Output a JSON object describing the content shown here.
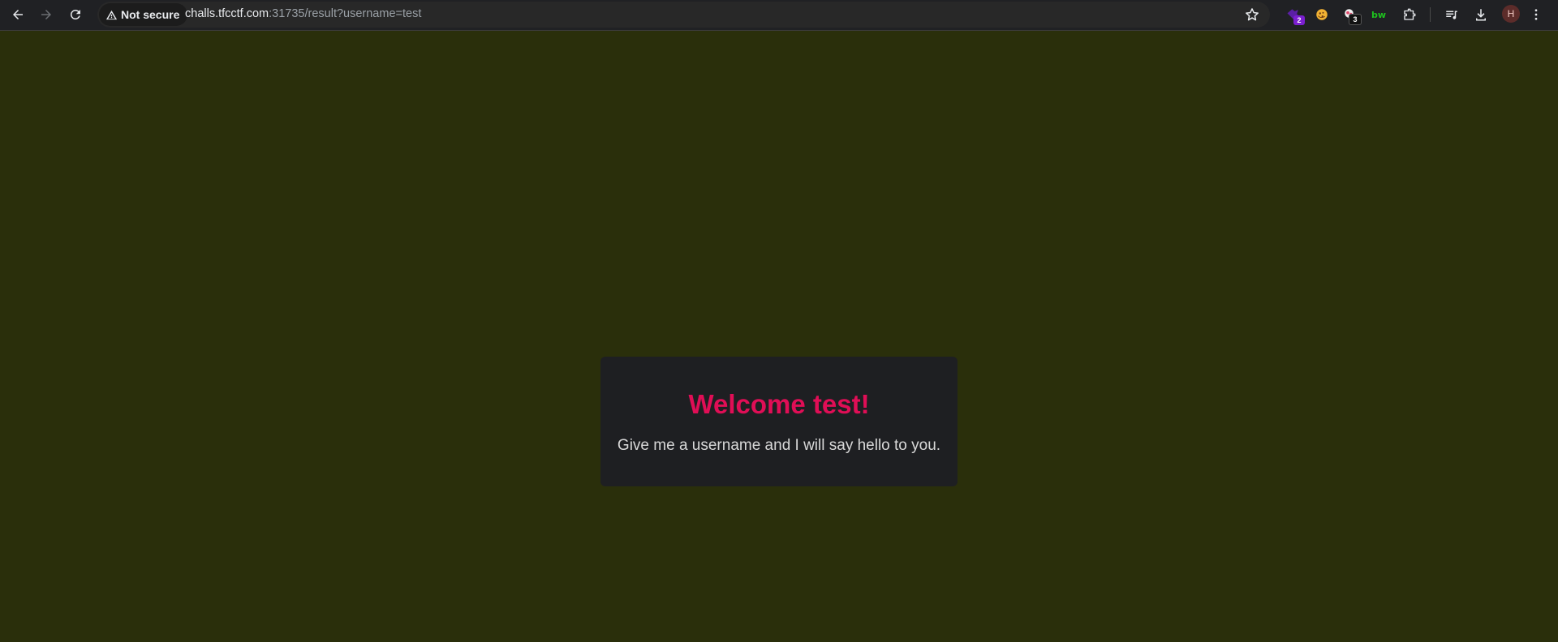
{
  "browser": {
    "security_label": "Not secure",
    "url_host": "challs.tfcctf.com",
    "url_rest": ":31735/result?username=test",
    "extensions": [
      {
        "name": "puzzle-ext-icon",
        "badge": "2",
        "badge_color": "#7b1fd1"
      },
      {
        "name": "cookie-ext-icon",
        "badge": ""
      },
      {
        "name": "clipper-ext-icon",
        "badge": "3",
        "badge_color": "#111111"
      },
      {
        "name": "bw-ext-icon",
        "label": "bw"
      }
    ],
    "profile_initial": "H"
  },
  "page": {
    "background": "#2a2f0b",
    "title": "Welcome test!",
    "message": "Give me a username and I will say hello to you.",
    "title_color": "#e00e56"
  }
}
